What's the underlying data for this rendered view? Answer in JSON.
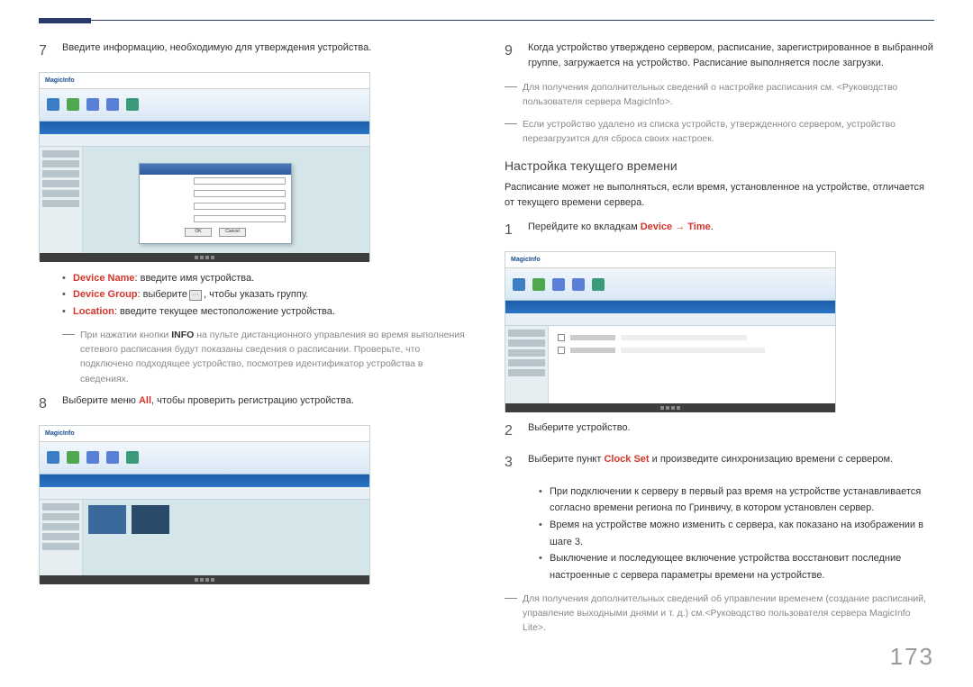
{
  "page_number": "173",
  "left": {
    "step7": {
      "num": "7",
      "text": "Введите информацию, необходимую для утверждения устройства."
    },
    "bullets7": {
      "device_name_label": "Device Name",
      "device_name_text": ": введите имя устройства.",
      "device_group_label": "Device Group",
      "device_group_text_a": ": выберите",
      "device_group_text_b": ", чтобы указать группу.",
      "location_label": "Location",
      "location_text": ": введите текущее местоположение устройства."
    },
    "note7": "При нажатии кнопки INFO на пульте дистанционного управления во время выполнения сетевого расписания будут показаны сведения о расписании. Проверьте, что подключено подходящее устройство, посмотрев идентификатор устройства в сведениях.",
    "note7_bold": "INFO",
    "step8": {
      "num": "8",
      "text_a": "Выберите меню ",
      "text_red": "All",
      "text_b": ", чтобы проверить регистрацию устройства."
    },
    "sc1": {
      "logo": "MagicInfo",
      "dlg_btn_ok": "OK",
      "dlg_btn_cancel": "Cancel"
    }
  },
  "right": {
    "step9": {
      "num": "9",
      "text": "Когда устройство утверждено сервером, расписание, зарегистрированное в выбранной группе, загружается на устройство. Расписание выполняется после загрузки."
    },
    "note9a": "Для получения дополнительных сведений о настройке расписания см. <Руководство пользователя сервера MagicInfo>.",
    "note9b": "Если устройство удалено из списка устройств, утвержденного сервером, устройство перезагрузится для сброса своих настроек.",
    "heading": "Настройка текущего времени",
    "intro": "Расписание может не выполняться, если время, установленное на устройстве, отличается от текущего времени сервера.",
    "step1": {
      "num": "1",
      "text_a": "Перейдите ко вкладкам ",
      "text_red": "Device → Time",
      "text_b": "."
    },
    "step2": {
      "num": "2",
      "text": "Выберите устройство."
    },
    "step3": {
      "num": "3",
      "text_a": "Выберите пункт ",
      "text_red": "Clock Set",
      "text_b": " и произведите синхронизацию времени с сервером."
    },
    "bullets3": {
      "b1": "При подключении к серверу в первый раз время на устройстве устанавливается согласно времени региона по Гринвичу, в котором установлен сервер.",
      "b2": "Время на устройстве можно изменить с сервера, как показано на изображении в шаге 3.",
      "b3": "Выключение и последующее включение устройства восстановит последние настроенные с сервера параметры времени на устройстве."
    },
    "note_final": "Для получения дополнительных сведений об управлении временем (создание расписаний, управление выходными днями и т. д.) см.<Руководство пользователя сервера MagicInfo Lite>."
  }
}
